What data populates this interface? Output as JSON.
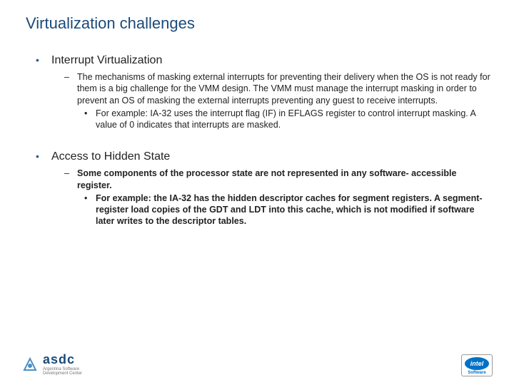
{
  "title": "Virtualization challenges",
  "items": [
    {
      "heading": "Interrupt Virtualization",
      "headingBold": false,
      "sub": {
        "text": "The mechanisms of masking external interrupts for preventing their delivery when the OS is not ready for them is a big challenge for the VMM design. The VMM must manage the interrupt masking in order to prevent an OS of masking the external interrupts preventing any guest to receive interrupts.",
        "bold": false,
        "subsub": {
          "text": "For example: IA-32 uses the interrupt flag (IF) in EFLAGS register to control interrupt masking. A value of 0 indicates that interrupts are masked.",
          "bold": false
        }
      }
    },
    {
      "heading": "Access to Hidden State",
      "headingBold": false,
      "sub": {
        "text": "Some components of the processor state are not represented in any software- accessible register.",
        "bold": true,
        "subsub": {
          "text": "For example: the IA-32 has the hidden descriptor caches for segment registers. A segment-register load copies of the GDT and LDT into this cache, which is not modified if software later writes to the descriptor tables.",
          "bold": true
        }
      }
    }
  ],
  "footer": {
    "asdc": {
      "name": "asdc",
      "line1": "Argentina Software",
      "line2": "Development Center"
    },
    "intel": {
      "brand": "intel",
      "sub": "Software"
    }
  }
}
